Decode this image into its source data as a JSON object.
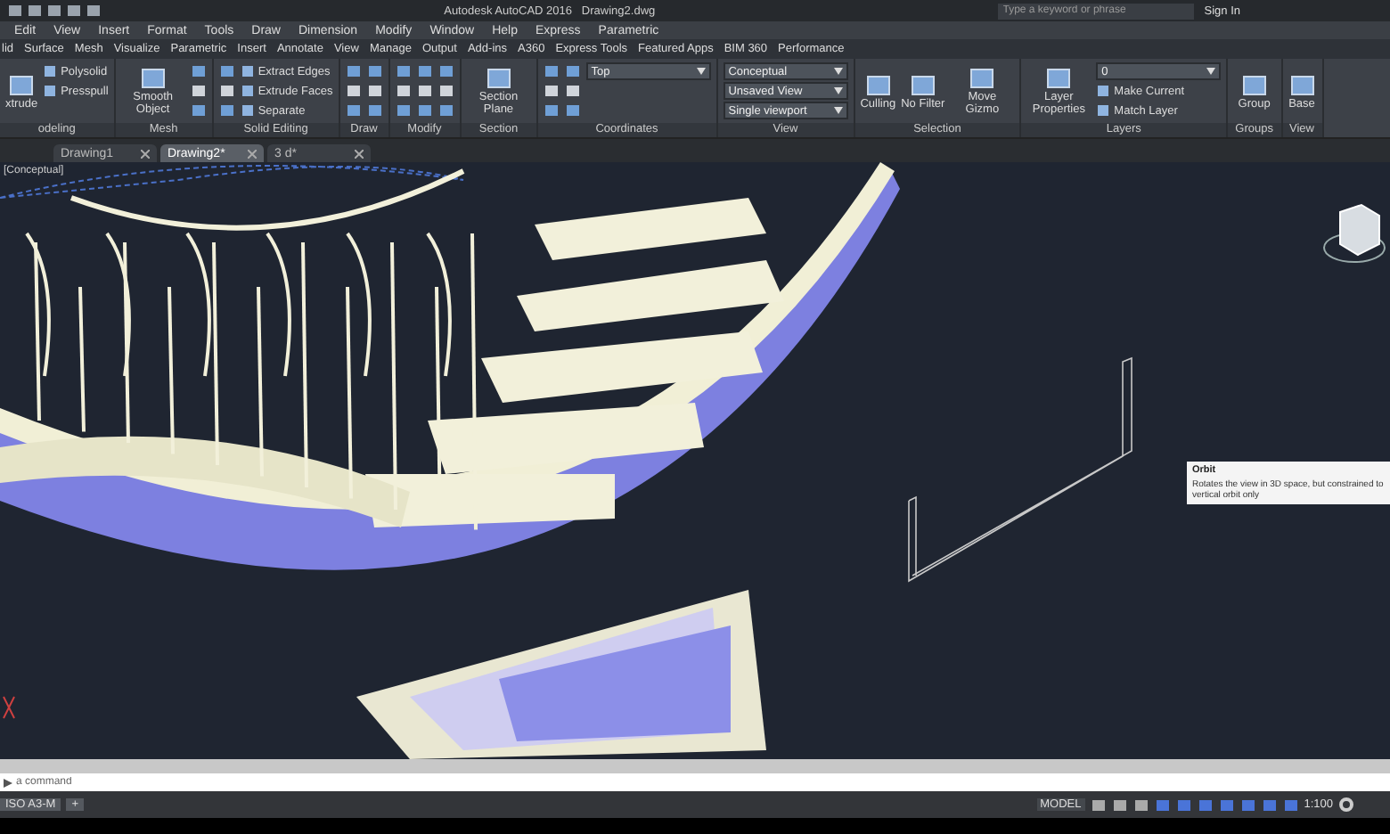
{
  "title_bar": {
    "title": "Autodesk AutoCAD 2016   Drawing2.dwg",
    "search": {
      "placeholder": "Type a keyword or phrase"
    },
    "sign_in": "Sign In"
  },
  "menu_bar": [
    "Edit",
    "View",
    "Insert",
    "Format",
    "Tools",
    "Draw",
    "Dimension",
    "Modify",
    "Window",
    "Help",
    "Express",
    "Parametric"
  ],
  "ribbon_tabs": [
    "lid",
    "Surface",
    "Mesh",
    "Visualize",
    "Parametric",
    "Insert",
    "Annotate",
    "View",
    "Manage",
    "Output",
    "Add-ins",
    "A360",
    "Express Tools",
    "Featured Apps",
    "BIM 360",
    "Performance"
  ],
  "ribbon_panels": [
    {
      "label": "odeling",
      "tools": [
        {
          "kind": "large",
          "label": "xtrude"
        },
        {
          "kind": "small",
          "label": "Polysolid"
        },
        {
          "kind": "small",
          "label": "Presspull"
        }
      ]
    },
    {
      "label": "Mesh",
      "tools": [
        {
          "kind": "large",
          "label": "Smooth Object"
        },
        {
          "kind": "icons"
        }
      ]
    },
    {
      "label": "Solid Editing",
      "tools": [
        {
          "kind": "icons"
        },
        {
          "kind": "small",
          "label": "Extract Edges"
        },
        {
          "kind": "small",
          "label": "Extrude Faces"
        },
        {
          "kind": "small",
          "label": "Separate"
        }
      ]
    },
    {
      "label": "Draw",
      "tools": [
        {
          "kind": "icons"
        },
        {
          "kind": "icons"
        }
      ]
    },
    {
      "label": "Modify",
      "tools": [
        {
          "kind": "icons"
        },
        {
          "kind": "icons"
        },
        {
          "kind": "icons"
        }
      ]
    },
    {
      "label": "Section",
      "tools": [
        {
          "kind": "large",
          "label": "Section Plane"
        }
      ]
    },
    {
      "label": "Coordinates",
      "tools": [
        {
          "kind": "icons"
        },
        {
          "kind": "icons"
        },
        {
          "kind": "dropdown",
          "label": "Top"
        }
      ]
    },
    {
      "label": "View",
      "tools": [
        {
          "kind": "dropdown",
          "label": "Conceptual"
        },
        {
          "kind": "dropdown",
          "label": "Unsaved View"
        },
        {
          "kind": "dropdown",
          "label": "Single viewport"
        }
      ]
    },
    {
      "label": "Selection",
      "tools": [
        {
          "kind": "large",
          "label": "Culling"
        },
        {
          "kind": "large",
          "label": "No Filter"
        },
        {
          "kind": "large",
          "label": "Move Gizmo"
        }
      ]
    },
    {
      "label": "Layers",
      "tools": [
        {
          "kind": "large",
          "label": "Layer Properties"
        },
        {
          "kind": "dropdown",
          "label": "0"
        },
        {
          "kind": "small",
          "label": "Make Current"
        },
        {
          "kind": "small",
          "label": "Match Layer"
        }
      ]
    },
    {
      "label": "Groups",
      "tools": [
        {
          "kind": "large",
          "label": "Group"
        }
      ]
    },
    {
      "label": "View",
      "tools": [
        {
          "kind": "large",
          "label": "Base"
        }
      ]
    }
  ],
  "doc_tabs": [
    {
      "label": "Drawing1",
      "selected": false
    },
    {
      "label": "Drawing2*",
      "selected": true
    },
    {
      "label": "3 d*",
      "selected": false
    }
  ],
  "viewport": {
    "label": "[Conceptual]",
    "tooltip": {
      "title": "Orbit",
      "body": "Rotates the view in 3D space, but constrained to vertical orbit only"
    }
  },
  "command_line": {
    "placeholder": "a command"
  },
  "layout_tabs": [
    "ISO A3-M",
    "+"
  ],
  "status_bar": {
    "mode": "MODEL",
    "scale": "1:100"
  }
}
